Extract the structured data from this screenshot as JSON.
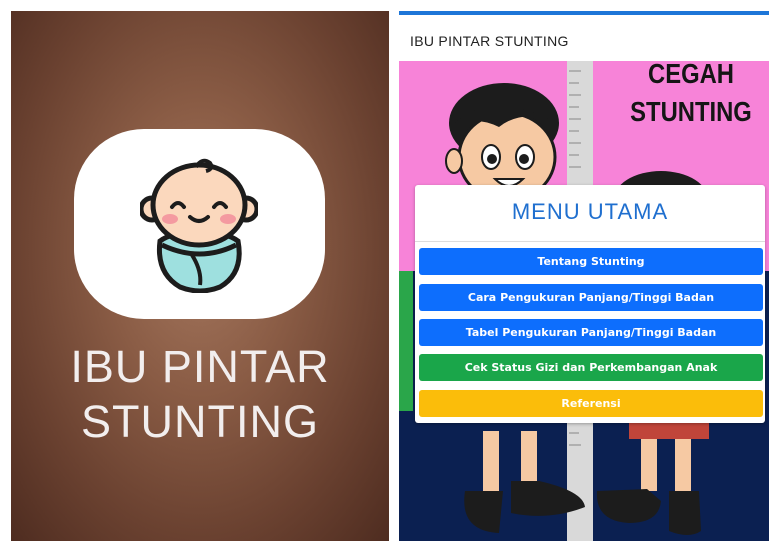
{
  "left_panel": {
    "app_name_line1": "IBU PINTAR",
    "app_name_line2": "STUNTING",
    "icon": "baby-icon"
  },
  "right_panel": {
    "appbar_title": "IBU PINTAR STUNTING",
    "poster": {
      "headline_line1": "CEGAH",
      "headline_line2": "STUNTING"
    },
    "menu": {
      "title": "MENU UTAMA",
      "items": [
        {
          "label": "Tentang Stunting",
          "color": "#0d6efd"
        },
        {
          "label": "Cara Pengukuran Panjang/Tinggi Badan",
          "color": "#0d6efd"
        },
        {
          "label": "Tabel Pengukuran Panjang/Tinggi Badan",
          "color": "#0d6efd"
        },
        {
          "label": "Cek Status Gizi dan Perkembangan Anak",
          "color": "#1aa64a"
        },
        {
          "label": "Referensi",
          "color": "#fbbd0a"
        }
      ]
    }
  },
  "colors": {
    "accent_blue": "#1d76d8",
    "poster_pink": "#f783d8",
    "poster_navy": "#0b2051"
  }
}
